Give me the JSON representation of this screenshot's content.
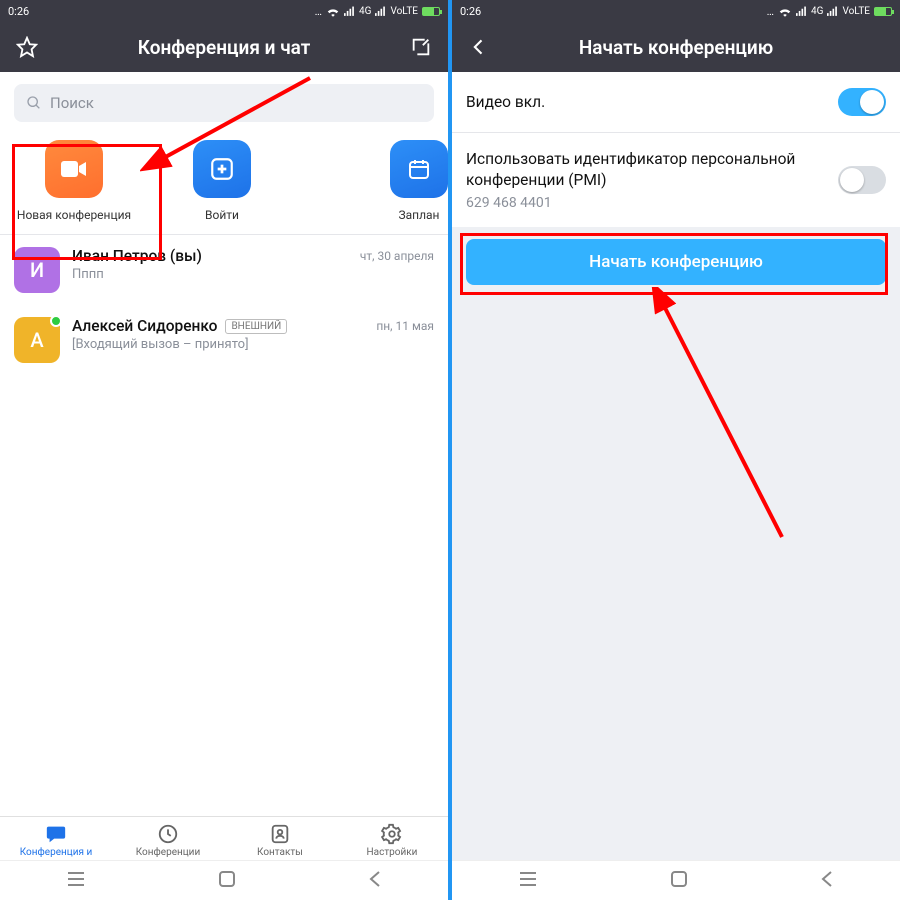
{
  "statusbar": {
    "time": "0:26",
    "net": "4G",
    "volte": "VoLTE"
  },
  "left": {
    "header_title": "Конференция и чат",
    "search_placeholder": "Поиск",
    "actions": {
      "new": "Новая конференция",
      "join": "Войти",
      "schedule": "Заплан"
    },
    "chats": [
      {
        "initial": "И",
        "name": "Иван Петров (вы)",
        "sub": "Пппп",
        "date": "чт, 30 апреля"
      },
      {
        "initial": "А",
        "name": "Алексей Сидоренко",
        "badge": "ВНЕШНИЙ",
        "sub": "[Входящий вызов – принято]",
        "date": "пн, 11 мая"
      }
    ],
    "tabs": {
      "chat": "Конференция и",
      "meetings": "Конференции",
      "contacts": "Контакты",
      "settings": "Настройки"
    }
  },
  "right": {
    "header_title": "Начать конференцию",
    "video_label": "Видео вкл.",
    "pmi_label": "Использовать идентификатор персональной конференции (PMI)",
    "pmi_number": "629 468 4401",
    "start_button": "Начать конференцию"
  }
}
